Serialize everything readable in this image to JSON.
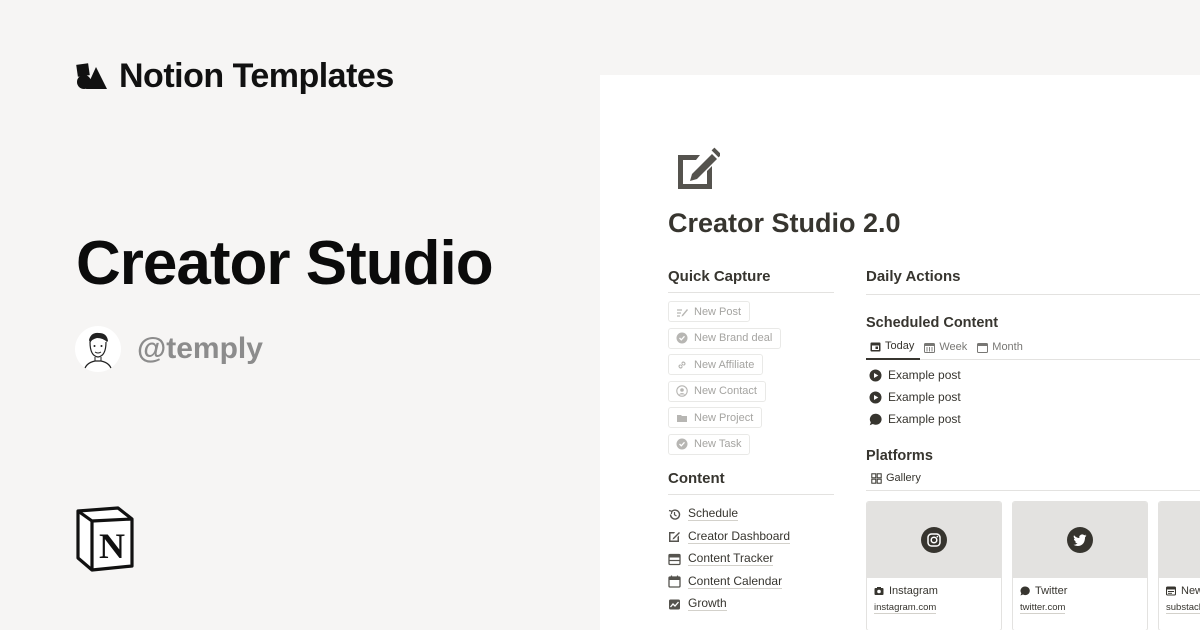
{
  "brand": {
    "text": "Notion Templates"
  },
  "hero": {
    "title": "Creator Studio",
    "handle": "@temply"
  },
  "page": {
    "title": "Creator Studio 2.0"
  },
  "quick_capture": {
    "heading": "Quick Capture",
    "buttons": [
      {
        "label": "New Post",
        "icon": "compose-icon"
      },
      {
        "label": "New Brand deal",
        "icon": "verified-icon"
      },
      {
        "label": "New Affiliate",
        "icon": "link-icon"
      },
      {
        "label": "New Contact",
        "icon": "contact-icon"
      },
      {
        "label": "New Project",
        "icon": "folder-icon"
      },
      {
        "label": "New Task",
        "icon": "check-circle-icon"
      }
    ]
  },
  "content": {
    "heading": "Content",
    "links": [
      {
        "label": "Schedule",
        "icon": "history-icon"
      },
      {
        "label": "Creator Dashboard",
        "icon": "edit-icon"
      },
      {
        "label": "Content Tracker",
        "icon": "table-icon"
      },
      {
        "label": "Content Calendar",
        "icon": "calendar-icon"
      },
      {
        "label": "Growth",
        "icon": "chart-icon"
      }
    ]
  },
  "daily_actions": {
    "heading": "Daily Actions"
  },
  "scheduled": {
    "heading": "Scheduled Content",
    "tabs": [
      {
        "label": "Today",
        "active": true
      },
      {
        "label": "Week",
        "active": false
      },
      {
        "label": "Month",
        "active": false
      }
    ],
    "posts": [
      {
        "label": "Example post",
        "icon": "play-icon"
      },
      {
        "label": "Example post",
        "icon": "play-icon"
      },
      {
        "label": "Example post",
        "icon": "chat-bubble-icon"
      }
    ]
  },
  "platforms": {
    "heading": "Platforms",
    "view": "Gallery",
    "cards": [
      {
        "name": "Instagram",
        "url": "instagram.com",
        "icon": "instagram-icon"
      },
      {
        "name": "Twitter",
        "url": "twitter.com",
        "icon": "twitter-icon"
      },
      {
        "name": "News",
        "url": "substack",
        "icon": "newsletter-icon"
      }
    ]
  },
  "colors": {
    "background": "#f6f5f4",
    "panel": "#ffffff",
    "text": "#37352f",
    "muted": "#a5a4a1",
    "handle": "#8c8c8c"
  }
}
